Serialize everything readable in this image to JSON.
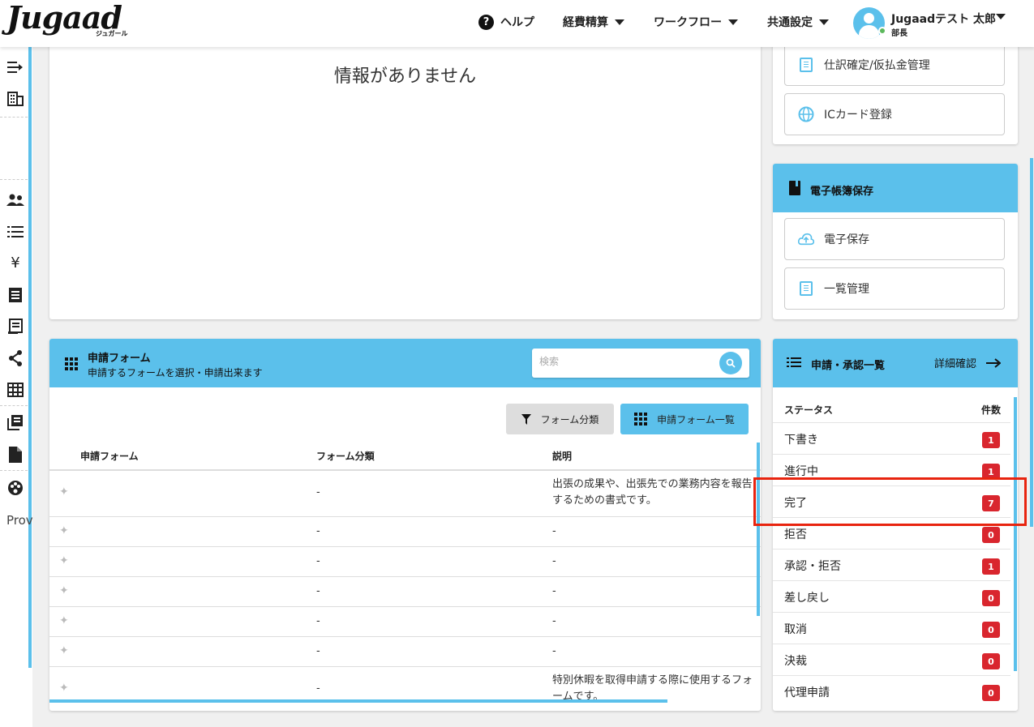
{
  "header": {
    "logo_text": "Jugaad",
    "logo_sub": "ジュガール",
    "help_label": "ヘルプ",
    "nav": [
      "経費精算",
      "ワークフロー",
      "共通設定"
    ],
    "user_name": "Jugaadテスト 太郎",
    "user_role": "部長"
  },
  "sidebar": {
    "icons": [
      "collapse-icon",
      "building-icon",
      "people-icon",
      "list-icon",
      "yen-icon",
      "receipt-icon",
      "ledger-icon",
      "share-icon",
      "table-icon",
      "library-icon",
      "file-icon",
      "palette-icon"
    ],
    "bottom_label": "Prov"
  },
  "top_card": {
    "empty_message": "情報がありません"
  },
  "right_links_top": [
    {
      "label": "仕訳確定/仮払金管理",
      "icon": "document-icon"
    },
    {
      "label": "ICカード登録",
      "icon": "globe-icon"
    }
  ],
  "ebook_panel": {
    "title": "電子帳簿保存",
    "links": [
      {
        "label": "電子保存",
        "icon": "cloud-upload-icon"
      },
      {
        "label": "一覧管理",
        "icon": "document-icon"
      }
    ]
  },
  "form_panel": {
    "title": "申請フォーム",
    "subtitle": "申請するフォームを選択・申請出来ます",
    "search_placeholder": "検索",
    "filter_button": "フォーム分類",
    "list_button": "申請フォーム一覧",
    "columns": [
      "申請フォーム",
      "フォーム分類",
      "説明"
    ],
    "rows": [
      {
        "name": "",
        "category": "-",
        "description": "出張の成果や、出張先での業務内容を報告するための書式です。"
      },
      {
        "name": "",
        "category": "-",
        "description": "-"
      },
      {
        "name": "",
        "category": "-",
        "description": "-"
      },
      {
        "name": "",
        "category": "-",
        "description": "-"
      },
      {
        "name": "",
        "category": "-",
        "description": "-"
      },
      {
        "name": "",
        "category": "-",
        "description": "-"
      },
      {
        "name": "",
        "category": "-",
        "description": "特別休暇を取得申請する際に使用するフォームです。"
      }
    ]
  },
  "status_panel": {
    "title": "申請・承認一覧",
    "detail_link": "詳細確認",
    "col_status": "ステータス",
    "col_count": "件数",
    "rows": [
      {
        "label": "下書き",
        "count": "1"
      },
      {
        "label": "進行中",
        "count": "1"
      },
      {
        "label": "完了",
        "count": "7"
      },
      {
        "label": "拒否",
        "count": "0"
      },
      {
        "label": "承認・拒否",
        "count": "1"
      },
      {
        "label": "差し戻し",
        "count": "0"
      },
      {
        "label": "取消",
        "count": "0"
      },
      {
        "label": "決裁",
        "count": "0"
      },
      {
        "label": "代理申請",
        "count": "0"
      }
    ]
  },
  "colors": {
    "accent": "#5bc0eb",
    "badge": "#d9262e",
    "highlight": "#e8240f"
  }
}
